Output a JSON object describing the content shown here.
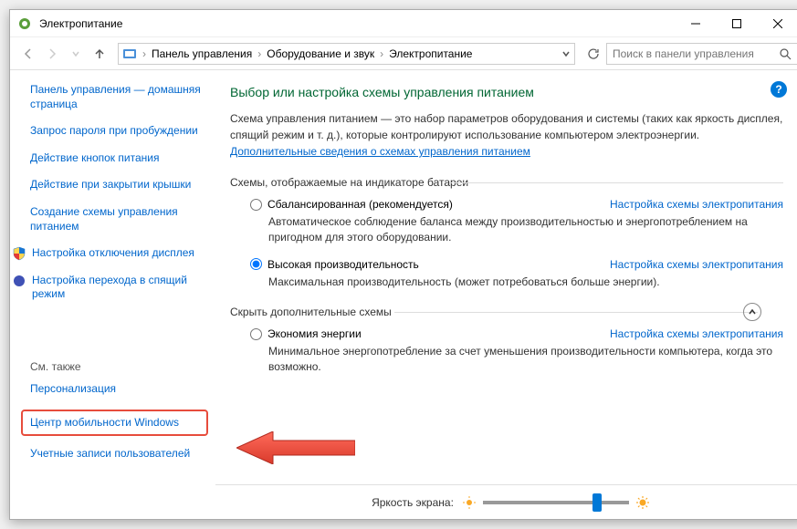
{
  "window": {
    "title": "Электропитание"
  },
  "breadcrumb": {
    "root": "Панель управления",
    "mid": "Оборудование и звук",
    "leaf": "Электропитание"
  },
  "search": {
    "placeholder": "Поиск в панели управления"
  },
  "sidebar": {
    "home": "Панель управления — домашняя страница",
    "links": [
      "Запрос пароля при пробуждении",
      "Действие кнопок питания",
      "Действие при закрытии крышки",
      "Создание схемы управления питанием",
      "Настройка отключения дисплея",
      "Настройка перехода в спящий режим"
    ],
    "see_also_label": "См. также",
    "see_also": [
      "Персонализация",
      "Центр мобильности Windows",
      "Учетные записи пользователей"
    ]
  },
  "main": {
    "heading": "Выбор или настройка схемы управления питанием",
    "desc": "Схема управления питанием — это набор параметров оборудования и системы (таких как яркость дисплея, спящий режим и т. д.), которые контролируют использование компьютером электроэнергии.",
    "desc_link": "Дополнительные сведения о схемах управления питанием",
    "section1_label": "Схемы, отображаемые на индикаторе батареи",
    "plan_settings_link": "Настройка схемы электропитания",
    "plans": [
      {
        "name": "Сбалансированная (рекомендуется)",
        "desc": "Автоматическое соблюдение баланса между производительностью и энергопотреблением на пригодном для этого оборудовании.",
        "checked": false
      },
      {
        "name": "Высокая производительность",
        "desc": "Максимальная производительность (может потребоваться больше энергии).",
        "checked": true
      }
    ],
    "section2_label": "Скрыть дополнительные схемы",
    "extra_plan": {
      "name": "Экономия энергии",
      "desc": "Минимальное энергопотребление за счет уменьшения производительности компьютера, когда это возможно."
    }
  },
  "brightness": {
    "label": "Яркость экрана:"
  }
}
